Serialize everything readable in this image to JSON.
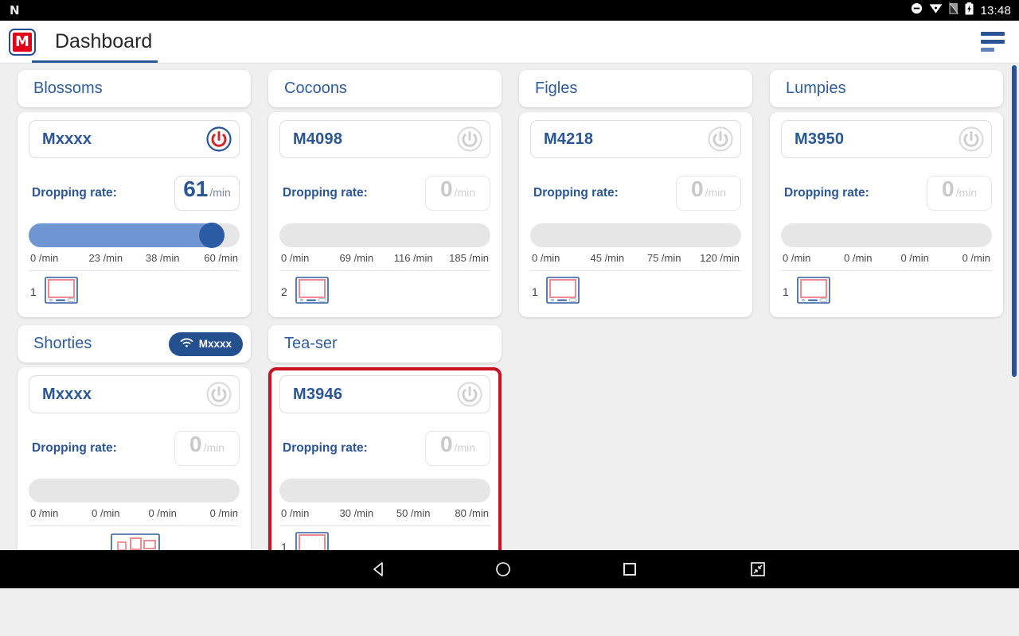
{
  "statusbar": {
    "app_icon": "n-app-icon",
    "dnd_icon": "do-not-disturb-icon",
    "wifi_icon": "wifi-icon",
    "signal_icon": "signal-icon",
    "battery_icon": "battery-charging-icon",
    "clock": "13:48"
  },
  "appbar": {
    "logo_letter": "M",
    "title": "Dashboard",
    "menu_icon": "hamburger-menu-icon"
  },
  "groups": [
    {
      "name": "Blossoms",
      "badge": null,
      "device": {
        "name": "Mxxxx",
        "power_state": "on",
        "rate_label": "Dropping rate:",
        "rate_value": "61",
        "rate_unit": "/min",
        "slider_percent": 93,
        "ticks": [
          "0 /min",
          "23 /min",
          "38 /min",
          "60 /min"
        ],
        "count": "1",
        "device_icon": "monitor-device-icon",
        "alert": false
      }
    },
    {
      "name": "Cocoons",
      "badge": null,
      "device": {
        "name": "M4098",
        "power_state": "off",
        "rate_label": "Dropping rate:",
        "rate_value": "0",
        "rate_unit": "/min",
        "slider_percent": 0,
        "ticks": [
          "0 /min",
          "69 /min",
          "116 /min",
          "185 /min"
        ],
        "count": "2",
        "device_icon": "monitor-device-icon",
        "alert": false
      }
    },
    {
      "name": "Figles",
      "badge": null,
      "device": {
        "name": "M4218",
        "power_state": "off",
        "rate_label": "Dropping rate:",
        "rate_value": "0",
        "rate_unit": "/min",
        "slider_percent": 0,
        "ticks": [
          "0 /min",
          "45 /min",
          "75 /min",
          "120 /min"
        ],
        "count": "1",
        "device_icon": "monitor-device-icon",
        "alert": false
      }
    },
    {
      "name": "Lumpies",
      "badge": null,
      "device": {
        "name": "M3950",
        "power_state": "off",
        "rate_label": "Dropping rate:",
        "rate_value": "0",
        "rate_unit": "/min",
        "slider_percent": 0,
        "ticks": [
          "0 /min",
          "0 /min",
          "0 /min",
          "0 /min"
        ],
        "count": "1",
        "device_icon": "monitor-device-icon",
        "alert": false
      }
    },
    {
      "name": "Shorties",
      "badge": {
        "icon": "wifi-icon",
        "label": "Mxxxx"
      },
      "device": {
        "name": "Mxxxx",
        "power_state": "off",
        "rate_label": "Dropping rate:",
        "rate_value": "0",
        "rate_unit": "/min",
        "slider_percent": 0,
        "ticks": [
          "0 /min",
          "0 /min",
          "0 /min",
          "0 /min"
        ],
        "count": "",
        "device_icon": "multi-module-device-icon",
        "alert": false
      }
    },
    {
      "name": "Tea-ser",
      "badge": null,
      "device": {
        "name": "M3946",
        "power_state": "off",
        "rate_label": "Dropping rate:",
        "rate_value": "0",
        "rate_unit": "/min",
        "slider_percent": 0,
        "ticks": [
          "0 /min",
          "30 /min",
          "50 /min",
          "80 /min"
        ],
        "count": "1",
        "device_icon": "monitor-device-icon",
        "alert": true
      }
    }
  ],
  "navbar": {
    "back_icon": "back-triangle-icon",
    "home_icon": "home-circle-icon",
    "recents_icon": "recents-square-icon",
    "resize_icon": "shrink-screen-icon"
  },
  "colors": {
    "brand_blue": "#2a5596",
    "brand_red": "#e2001a",
    "alert_red": "#cc1122",
    "slider_fill": "#6f95d2",
    "slider_thumb": "#2d5ca6",
    "page_bg": "#efefef"
  }
}
